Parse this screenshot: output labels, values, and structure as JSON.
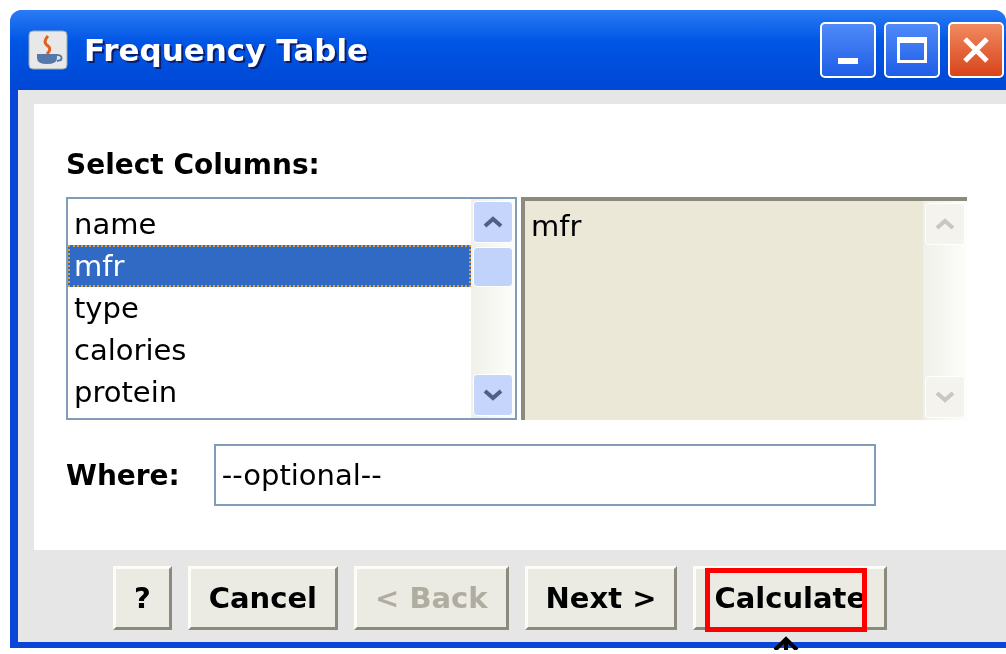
{
  "window": {
    "title": "Frequency Table"
  },
  "select_label": "Select Columns:",
  "columns_list": {
    "items": [
      {
        "label": "name",
        "selected": false
      },
      {
        "label": "mfr",
        "selected": true
      },
      {
        "label": "type",
        "selected": false
      },
      {
        "label": "calories",
        "selected": false
      },
      {
        "label": "protein",
        "selected": false
      }
    ]
  },
  "selected_list": {
    "items": [
      "mfr"
    ]
  },
  "where": {
    "label": "Where:",
    "value": "--optional--"
  },
  "buttons": [
    {
      "label": "?",
      "disabled": false,
      "highlighted": false
    },
    {
      "label": "Cancel",
      "disabled": false,
      "highlighted": false
    },
    {
      "label": "< Back",
      "disabled": true,
      "highlighted": false
    },
    {
      "label": "Next >",
      "disabled": false,
      "highlighted": false
    },
    {
      "label": "Calculate",
      "disabled": false,
      "highlighted": true
    }
  ]
}
